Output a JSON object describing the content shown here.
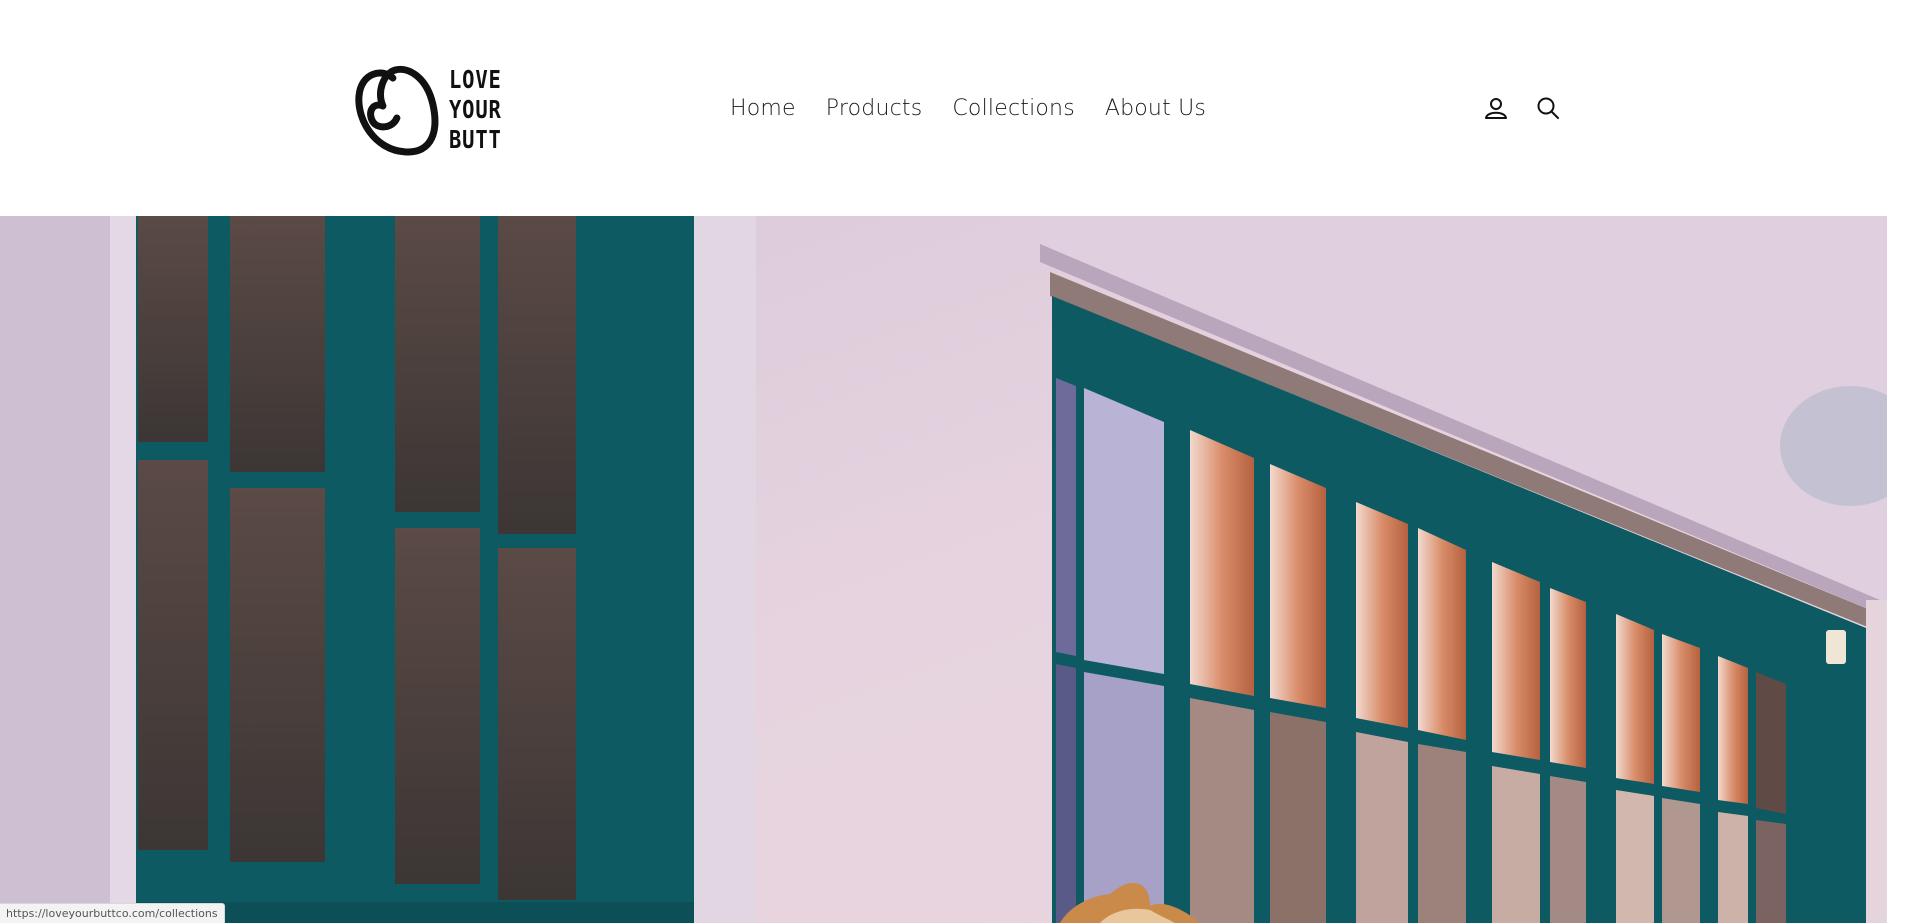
{
  "header": {
    "logo": {
      "line1": "LOVE",
      "line2": "YOUR",
      "line3": "BUTT"
    },
    "nav": [
      {
        "label": "Home"
      },
      {
        "label": "Products"
      },
      {
        "label": "Collections"
      },
      {
        "label": "About Us"
      }
    ],
    "icons": [
      "account-icon",
      "search-icon"
    ]
  },
  "hero": {
    "image": "dog-in-front-of-lavender-wall-with-teal-windows"
  },
  "status_bar": {
    "url": "https://loveyourbuttco.com/collections"
  },
  "colors": {
    "wall": "#e2d0de",
    "window_frame": "#0e5a63",
    "header_bg": "#ffffff",
    "text": "#1a1a1a"
  }
}
